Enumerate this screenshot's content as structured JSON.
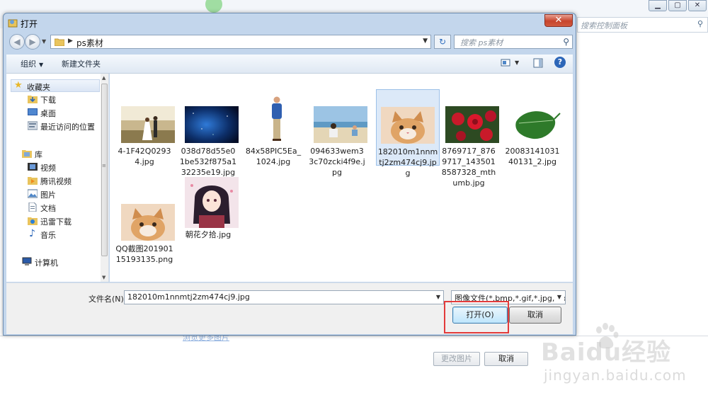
{
  "background": {
    "search_placeholder": "搜索控制面板",
    "link_text": "浏览更多图片",
    "change_button": "更改图片",
    "cancel_button": "取消"
  },
  "watermark": {
    "brand": "Baidu经验",
    "url": "jingyan.baidu.com"
  },
  "dialog": {
    "title": "打开",
    "close_label": "✕",
    "address": {
      "path": "ps素材"
    },
    "search": {
      "placeholder": "搜索 ps素材"
    },
    "toolbar": {
      "organize": "组织",
      "new_folder": "新建文件夹"
    },
    "nav": [
      {
        "label": "收藏夹",
        "icon": "star-icon",
        "selected": true
      },
      {
        "label": "下载",
        "icon": "download-folder-icon"
      },
      {
        "label": "桌面",
        "icon": "desktop-icon"
      },
      {
        "label": "最近访问的位置",
        "icon": "recent-places-icon"
      },
      {
        "label": "库",
        "icon": "library-icon"
      },
      {
        "label": "视频",
        "icon": "video-icon"
      },
      {
        "label": "腾讯视频",
        "icon": "tencent-video-icon"
      },
      {
        "label": "图片",
        "icon": "picture-icon"
      },
      {
        "label": "文档",
        "icon": "document-icon"
      },
      {
        "label": "迅雷下载",
        "icon": "xunlei-folder-icon"
      },
      {
        "label": "音乐",
        "icon": "music-icon"
      },
      {
        "label": "计算机",
        "icon": "computer-icon"
      }
    ],
    "files": [
      {
        "name": "4-1F42Q02934.jpg",
        "selected": false
      },
      {
        "name": "038d78d55e01be532f875a132235e19.jpg",
        "selected": false
      },
      {
        "name": "84x58PIC5Ea_1024.jpg",
        "selected": false
      },
      {
        "name": "094633wem33c70zcki4f9e.jpg",
        "selected": false
      },
      {
        "name": "182010m1nnmtj2zm474cj9.jpg",
        "selected": true
      },
      {
        "name": "8769717_8769717_1435018587328_mthumb.jpg",
        "selected": false
      },
      {
        "name": "20083141031 40131_2.jpg",
        "selected": false
      },
      {
        "name": "QQ截图20190115193135.png",
        "selected": false
      },
      {
        "name": "朝花夕拾.jpg",
        "selected": false
      }
    ],
    "filename_label": "文件名(N):",
    "filename_value": "182010m1nnmtj2zm474cj9.jpg",
    "filetype_value": "图像文件(*.bmp,*.gif,*.jpg,*.pr",
    "open_button": "打开(O)",
    "cancel_button": "取消"
  }
}
